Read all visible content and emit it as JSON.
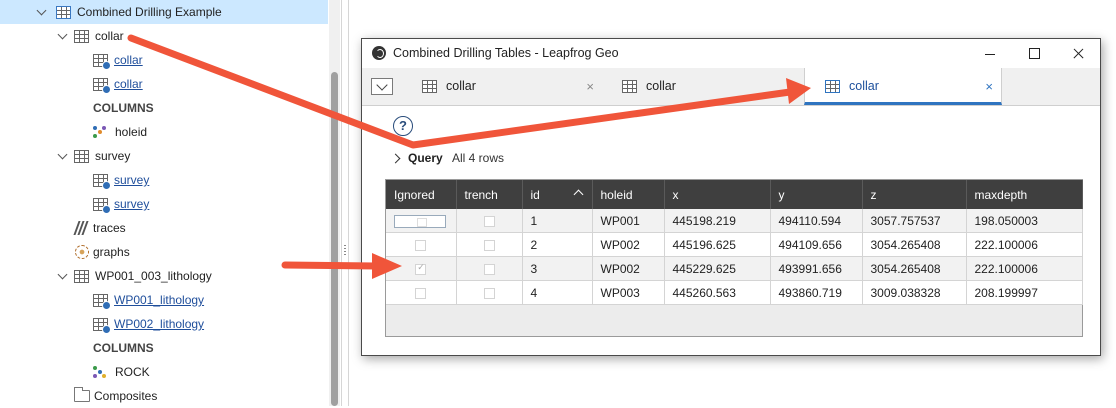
{
  "tree": {
    "items": [
      {
        "label": "Combined Drilling Example",
        "kind": "combined-table",
        "selected": true
      },
      {
        "label": "collar",
        "kind": "table"
      },
      {
        "label": "collar",
        "kind": "subtable-link"
      },
      {
        "label": "collar",
        "kind": "subtable-link"
      },
      {
        "label": "COLUMNS",
        "kind": "section"
      },
      {
        "label": "holeid",
        "kind": "column"
      },
      {
        "label": "survey",
        "kind": "table"
      },
      {
        "label": "survey",
        "kind": "subtable-link"
      },
      {
        "label": "survey",
        "kind": "subtable-link"
      },
      {
        "label": "traces",
        "kind": "traces"
      },
      {
        "label": "graphs",
        "kind": "graphs"
      },
      {
        "label": "WP001_003_lithology",
        "kind": "table"
      },
      {
        "label": "WP001_lithology",
        "kind": "subtable-link"
      },
      {
        "label": "WP002_lithology",
        "kind": "subtable-link"
      },
      {
        "label": "COLUMNS",
        "kind": "section"
      },
      {
        "label": "ROCK",
        "kind": "column"
      },
      {
        "label": "Composites",
        "kind": "folder"
      }
    ]
  },
  "window": {
    "title": "Combined Drilling Tables - Leapfrog Geo",
    "tabs": [
      {
        "label": "collar",
        "close": "×",
        "active": false
      },
      {
        "label": "collar",
        "close": "",
        "active": false
      },
      {
        "label": "collar",
        "close": "×",
        "active": true
      }
    ],
    "help": "?",
    "query_label": "Query",
    "rows_label": "All 4 rows"
  },
  "grid": {
    "columns": [
      "Ignored",
      "trench",
      "id",
      "holeid",
      "x",
      "y",
      "z",
      "maxdepth"
    ],
    "sorted_column": "id",
    "rows": [
      {
        "ignored": "editing",
        "trench": false,
        "id": "1",
        "holeid": "WP001",
        "x": "445198.219",
        "y": "494110.594",
        "z": "3057.757537",
        "maxdepth": "198.050003"
      },
      {
        "ignored": false,
        "trench": false,
        "id": "2",
        "holeid": "WP002",
        "x": "445196.625",
        "y": "494109.656",
        "z": "3054.265408",
        "maxdepth": "222.100006"
      },
      {
        "ignored": true,
        "trench": false,
        "id": "3",
        "holeid": "WP002",
        "x": "445229.625",
        "y": "493991.656",
        "z": "3054.265408",
        "maxdepth": "222.100006"
      },
      {
        "ignored": false,
        "trench": false,
        "id": "4",
        "holeid": "WP003",
        "x": "445260.563",
        "y": "493860.719",
        "z": "3009.038328",
        "maxdepth": "208.199997"
      }
    ]
  },
  "colors": {
    "accent": "#2f74c0",
    "annotation_arrow": "#f0553a",
    "selection": "#cce8ff",
    "grid_header": "#3f3f3f"
  }
}
